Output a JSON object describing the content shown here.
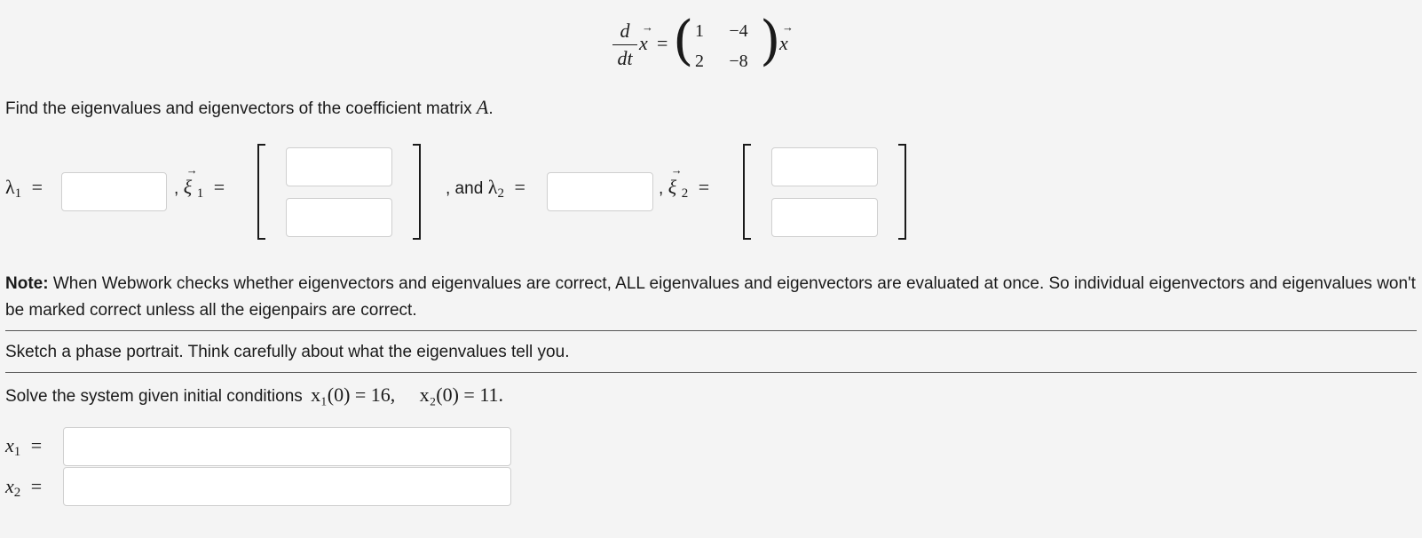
{
  "equation": {
    "derivative_num": "d",
    "derivative_den": "dt",
    "vector_symbol": "x",
    "equals": "=",
    "matrix": [
      [
        "1",
        "−4"
      ],
      [
        "2",
        "−8"
      ]
    ]
  },
  "prompt_eigen": "Find the eigenvalues and eigenvectors of the coefficient matrix",
  "matrix_symbol": "A",
  "period": ".",
  "eigen_row": {
    "lambda1_label": "λ",
    "lambda1_sub": "1",
    "xi1_label": "ξ",
    "xi1_sub": "1",
    "and_text": ", and",
    "lambda2_label": "λ",
    "lambda2_sub": "2",
    "xi2_label": "ξ",
    "xi2_sub": "2",
    "comma": ",",
    "equals": "="
  },
  "note": {
    "bold": "Note:",
    "text": " When Webwork checks whether eigenvectors and eigenvalues are correct, ALL eigenvalues and eigenvectors are evaluated at once. So individual eigenvectors and eigenvalues won't be marked correct unless all the eigenpairs are correct."
  },
  "sketch_text": "Sketch a phase portrait. Think carefully about what the eigenvalues tell you.",
  "solve": {
    "text": "Solve the system given initial conditions",
    "condition1": "x₁(0) = 16,",
    "condition2": "x₂(0) = 11."
  },
  "solution_labels": {
    "x1": "x",
    "x1_sub": "1",
    "x2": "x",
    "x2_sub": "2",
    "equals": "="
  },
  "answers": {
    "lambda1": "",
    "xi1_top": "",
    "xi1_bottom": "",
    "lambda2": "",
    "xi2_top": "",
    "xi2_bottom": "",
    "x1": "",
    "x2": ""
  }
}
